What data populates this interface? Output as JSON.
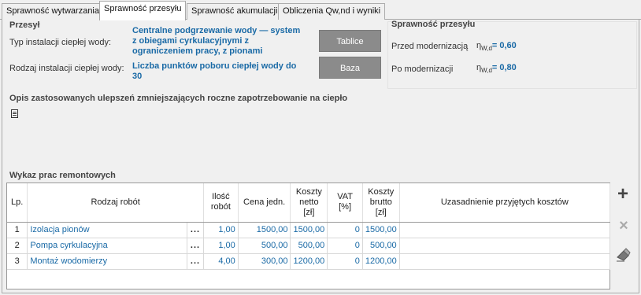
{
  "tabs": [
    {
      "label": "Sprawność wytwarzania"
    },
    {
      "label": "Sprawność przesyłu"
    },
    {
      "label": "Sprawność akumulacji"
    },
    {
      "label": "Obliczenia Qw,nd i wyniki"
    }
  ],
  "przesyl": {
    "title": "Przesył",
    "typ_label": "Typ instalacji ciepłej wody:",
    "typ_value_lines": [
      "Centralne podgrzewanie wody — system",
      "z obiegami cyrkulacyjnymi z",
      "ograniczeniem pracy, z pionami"
    ],
    "rodzaj_label": "Rodzaj instalacji ciepłej wody:",
    "rodzaj_value_lines": [
      "Liczba punktów poboru ciepłej wody do",
      "30"
    ],
    "btn_tablice": "Tablice",
    "btn_baza": "Baza"
  },
  "sprawnosc": {
    "title": "Sprawność przesyłu",
    "przed_label": "Przed modernizacją",
    "po_label": "Po modernizacji",
    "eta_symbol": "η",
    "eta_sub": "W,d",
    "przed_value": "= 0,60",
    "po_value": "= 0,80"
  },
  "opis": {
    "title": "Opis zastosowanych ulepszeń zmniejszających roczne zapotrzebowanie na ciepło"
  },
  "wykaz": {
    "title": "Wykaz prac remontowych",
    "columns": {
      "lp": "Lp.",
      "rodzaj": "Rodzaj robót",
      "ilosc": [
        "Ilość",
        "robót"
      ],
      "cena": "Cena jedn.",
      "netto": [
        "Koszty",
        "netto",
        "[zł]"
      ],
      "vat": [
        "VAT",
        "[%]"
      ],
      "brutto": [
        "Koszty",
        "brutto",
        "[zł]"
      ],
      "uzas": "Uzasadnienie przyjętych kosztów"
    },
    "rows": [
      {
        "lp": "1",
        "rodzaj": "Izolacja pionów",
        "dots": "...",
        "ilosc": "1,00",
        "cena": "1500,00",
        "netto": "1500,00",
        "vat": "0",
        "brutto": "1500,00",
        "uzas": ""
      },
      {
        "lp": "2",
        "rodzaj": "Pompa cyrkulacyjna",
        "dots": "...",
        "ilosc": "1,00",
        "cena": "500,00",
        "netto": "500,00",
        "vat": "0",
        "brutto": "500,00",
        "uzas": ""
      },
      {
        "lp": "3",
        "rodzaj": "Montaż wodomierzy",
        "dots": "...",
        "ilosc": "4,00",
        "cena": "300,00",
        "netto": "1200,00",
        "vat": "0",
        "brutto": "1200,00",
        "uzas": ""
      }
    ]
  },
  "side_buttons": {
    "add_glyph": "+",
    "delete_glyph": "×"
  },
  "icons": [
    "document-icon",
    "add-icon",
    "delete-icon",
    "eraser-icon"
  ]
}
